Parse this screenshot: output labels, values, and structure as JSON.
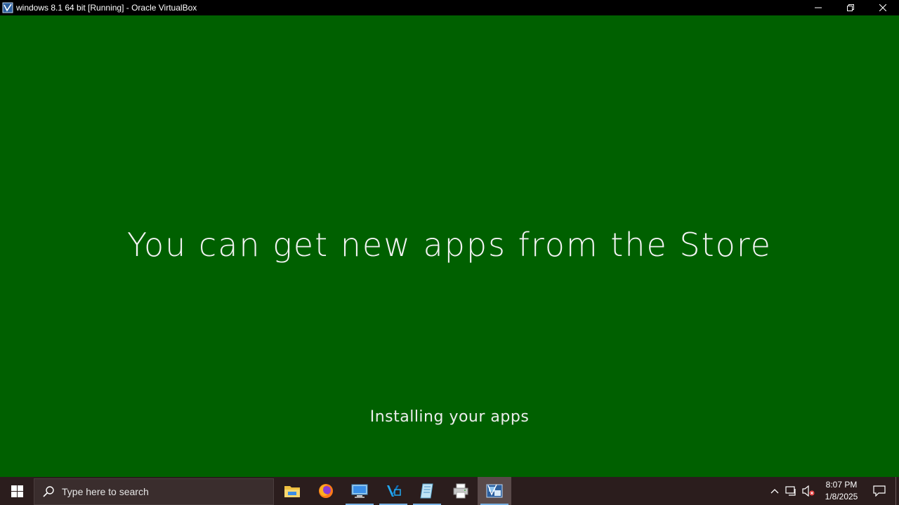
{
  "window": {
    "title": "windows 8.1 64 bit [Running] - Oracle VirtualBox",
    "icon": "virtualbox-icon"
  },
  "guest": {
    "background_color": "#006000",
    "headline": "You can get new apps from the Store",
    "status": "Installing your apps"
  },
  "taskbar": {
    "search_placeholder": "Type here to search",
    "apps": [
      {
        "name": "file-explorer-icon",
        "running": false
      },
      {
        "name": "firefox-icon",
        "running": false
      },
      {
        "name": "remote-desktop-icon",
        "running": true
      },
      {
        "name": "visual-studio-code-icon",
        "running": true
      },
      {
        "name": "notepad-icon",
        "running": true
      },
      {
        "name": "printer-icon",
        "running": false
      },
      {
        "name": "virtualbox-icon",
        "running": true,
        "active": true
      }
    ],
    "tray": {
      "time": "8:07 PM",
      "date": "1/8/2025"
    }
  }
}
